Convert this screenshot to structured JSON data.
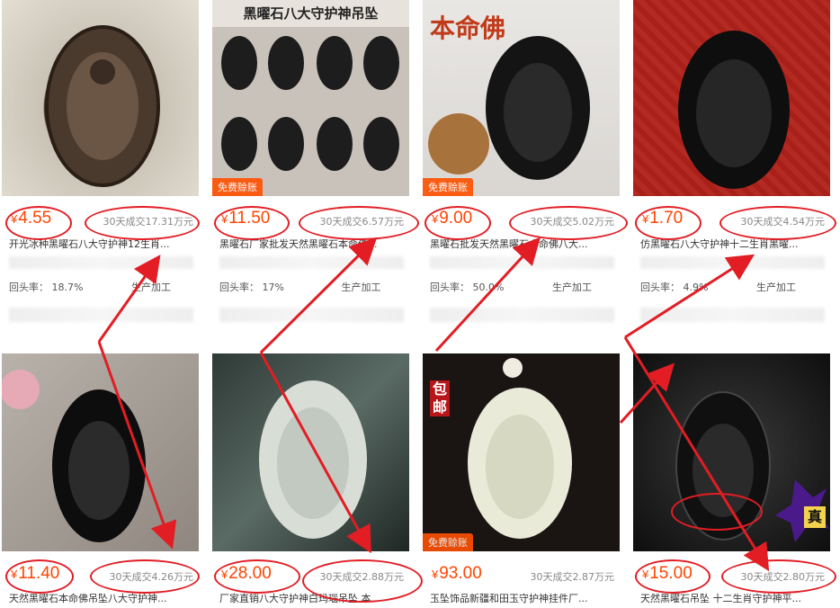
{
  "free_shipping_label": "免费赊账",
  "currency": "¥",
  "products": [
    {
      "price": "4.55",
      "sales": "30天成交17.31万元",
      "title": "开光冰种黑曜石八大守护神12生肖...",
      "repeat": "回头率：",
      "repeat_pct": "18.7%",
      "tag": "生产加工",
      "img_theme": "brown",
      "img_caption": ""
    },
    {
      "price": "11.50",
      "sales": "30天成交6.57万元",
      "title": "黑曜石厂家批发天然黑曜石本命佛...",
      "repeat": "回头率：",
      "repeat_pct": "17%",
      "tag": "生产加工",
      "img_theme": "grid",
      "img_caption": "黑曜石八大守护神吊坠"
    },
    {
      "price": "9.00",
      "sales": "30天成交5.02万元",
      "title": "黑曜石批发天然黑曜石本命佛八大...",
      "repeat": "回头率：",
      "repeat_pct": "50.0%",
      "tag": "生产加工",
      "img_theme": "black",
      "img_caption": "本命佛"
    },
    {
      "price": "1.70",
      "sales": "30天成交4.54万元",
      "title": "仿黑曜石八大守护神十二生肖黑曜...",
      "repeat": "回头率：",
      "repeat_pct": "4.9%",
      "tag": "生产加工",
      "img_theme": "red",
      "img_caption": ""
    },
    {
      "price": "11.40",
      "sales": "30天成交4.26万元",
      "title": "天然黑曜石本命佛吊坠八大守护神...",
      "img_theme": "grey",
      "img_caption": ""
    },
    {
      "price": "28.00",
      "sales": "30天成交2.88万元",
      "title": "厂家直销八大守护神白玛瑙吊坠 本...",
      "img_theme": "jade",
      "img_caption": ""
    },
    {
      "price": "93.00",
      "sales": "30天成交2.87万元",
      "title": "玉坠饰品新疆和田玉守护神挂件厂...",
      "img_theme": "white",
      "img_caption": "包邮"
    },
    {
      "price": "15.00",
      "sales": "30天成交2.80万元",
      "title": "天然黑曜石吊坠 十二生肖守护神平...",
      "img_theme": "dark",
      "img_caption": "真"
    }
  ],
  "colors": {
    "price": "#ff4400",
    "annotation": "#e21d24",
    "badge": "#ff5000"
  }
}
